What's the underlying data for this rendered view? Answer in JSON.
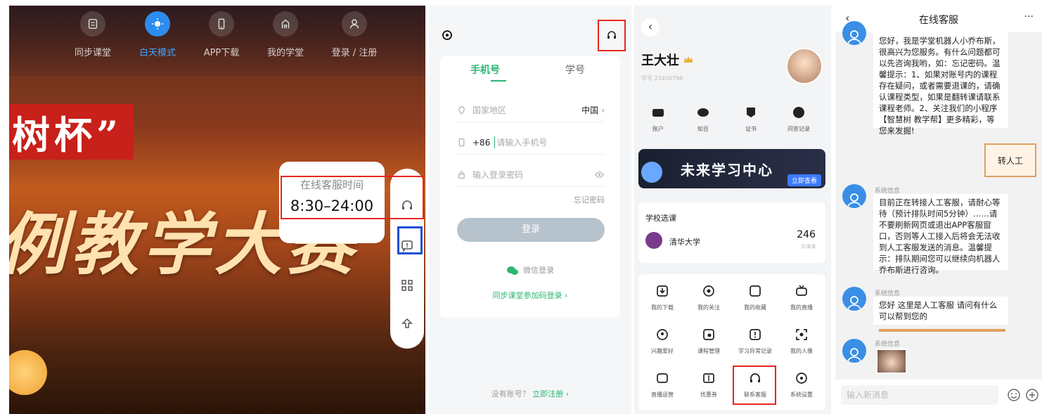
{
  "web": {
    "nav": [
      {
        "label": "同步课堂",
        "icon": "book-icon"
      },
      {
        "label": "白天模式",
        "icon": "sun-icon"
      },
      {
        "label": "APP下载",
        "icon": "phone-icon"
      },
      {
        "label": "我的学堂",
        "icon": "home-icon"
      },
      {
        "label": "登录 / 注册",
        "icon": "user-icon"
      }
    ],
    "banner_line1": "树杯”",
    "banner_line2": "例教学大赛",
    "tooltip": {
      "title": "在线客服时间",
      "time": "8:30–24:00"
    },
    "rail": [
      "headset-icon",
      "feedback-icon",
      "qr-code-icon",
      "back-to-top-icon"
    ]
  },
  "login": {
    "tabs": [
      "手机号",
      "学号"
    ],
    "region_label": "国家地区",
    "region_value": "中国",
    "country_code": "+86",
    "phone_placeholder": "请输入手机号",
    "password_placeholder": "输入登录密码",
    "forgot": "忘记密码",
    "login_button": "登录",
    "wechat": "微信登录",
    "class_code_login": "同步课堂参加码登录 ›",
    "no_account": "没有账号？",
    "register": "立即注册 ›"
  },
  "profile": {
    "name": "王大壮",
    "student_id": "学号 23456798",
    "quick": [
      {
        "label": "账户"
      },
      {
        "label": "知豆"
      },
      {
        "label": "证书"
      },
      {
        "label": "问答记录"
      }
    ],
    "banner_title": "未来学习中心",
    "banner_btn": "立即查看",
    "school_section": "学校选课",
    "school": "清华大学",
    "course_count": "246",
    "course_count_label": "共课课",
    "grid": [
      {
        "label": "我的下载"
      },
      {
        "label": "我的关注"
      },
      {
        "label": "我的收藏"
      },
      {
        "label": "我的直播"
      },
      {
        "label": "兴趣爱好"
      },
      {
        "label": "课程管理"
      },
      {
        "label": "学习异常记录"
      },
      {
        "label": "我的人像"
      },
      {
        "label": "直播运营"
      },
      {
        "label": "优惠券"
      },
      {
        "label": "联系客服"
      },
      {
        "label": "系统设置"
      }
    ]
  },
  "chat": {
    "title": "在线客服",
    "more": "···",
    "msg1": "您好，我是学堂机器人小乔布斯，很高兴为您服务。有什么问题都可以先咨询我哟，如：忘记密码。温馨提示：1、如果对账号内的课程存在疑问，或者需要退课的，请确认课程类型，如果是翻转课请联系课程老师。2、关注我们的小程序【智慧树 教学帮】更多精彩，等您来发掘!",
    "user_msg": "转人工",
    "sys_label": "系统信息",
    "msg2": "目前正在转接人工客服，请耐心等待（预计排队时间5分钟）……请不要刷新网页或退出APP客服窗口，否则等人工接入后将会无法收到人工客服发送的消息。温馨提示：排队期间您可以继续向机器人乔布斯进行咨询。",
    "msg3": "您好 这里是人工客服 请问有什么可以帮到您的",
    "input_placeholder": "输入新消息"
  },
  "colors": {
    "accent_green": "#2bb673",
    "highlight_red": "#e8261f",
    "highlight_blue": "#1a4fd6",
    "nav_active": "#3ea4ff"
  }
}
